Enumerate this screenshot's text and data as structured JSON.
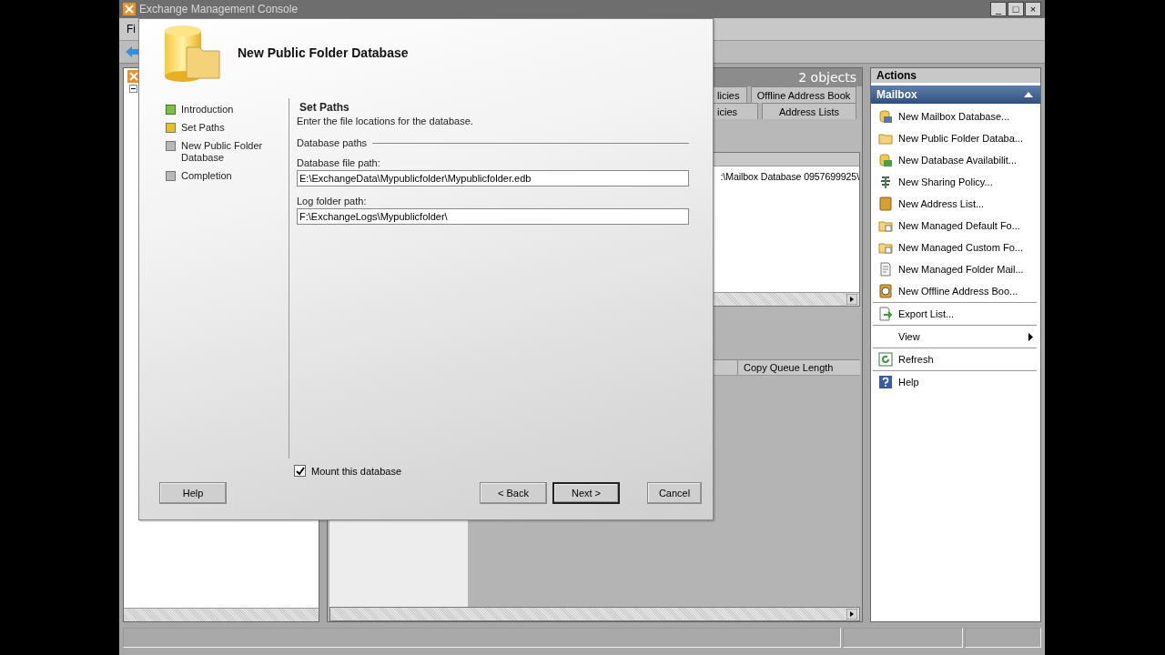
{
  "window": {
    "title": "Exchange Management Console",
    "controls": [
      "_",
      "□",
      "×"
    ]
  },
  "menu_bar": {
    "items": [
      "Fi"
    ]
  },
  "center_pane": {
    "count": "2 objects",
    "tabs_row_1": [
      {
        "label": "licies",
        "selected": false
      },
      {
        "label": "Offline Address Book",
        "selected": false
      }
    ],
    "tabs_row_2": [
      {
        "label": "icies",
        "selected": false
      },
      {
        "label": "Address Lists",
        "selected": false
      }
    ],
    "rows": [
      {
        "cell": ":\\Mailbox Database 0957699925\\"
      }
    ],
    "copies_columns": [
      "Copy Queue Length"
    ]
  },
  "actions_pane": {
    "title": "Actions",
    "section": {
      "title": "Mailbox",
      "expanded": true
    },
    "groups": [
      [
        {
          "label": "New Mailbox Database...",
          "kind": "action"
        },
        {
          "label": "New Public Folder Databa...",
          "kind": "action"
        },
        {
          "label": "New Database Availabilit...",
          "kind": "action"
        },
        {
          "label": "New Sharing Policy...",
          "kind": "action"
        },
        {
          "label": "New Address List...",
          "kind": "action"
        },
        {
          "label": "New Managed Default Fo...",
          "kind": "action"
        },
        {
          "label": "New Managed Custom Fo...",
          "kind": "action"
        },
        {
          "label": "New Managed Folder Mail...",
          "kind": "action"
        },
        {
          "label": "New Offline Address Boo...",
          "kind": "action"
        }
      ],
      [
        {
          "label": "Export List...",
          "kind": "action"
        }
      ],
      [
        {
          "label": "View",
          "kind": "submenu"
        }
      ],
      [
        {
          "label": "Refresh",
          "kind": "action"
        }
      ],
      [
        {
          "label": "Help",
          "kind": "action"
        }
      ]
    ]
  },
  "dialog": {
    "title": "New Public Folder Database",
    "steps": [
      {
        "label": "Introduction",
        "completed": true,
        "selected": false
      },
      {
        "label": "Set Paths",
        "completed": false,
        "selected": true
      },
      {
        "label": "New Public Folder Database",
        "completed": false,
        "selected": false
      },
      {
        "label": "Completion",
        "completed": false,
        "selected": false
      }
    ],
    "heading": "Set Paths",
    "description": "Enter the file locations for the database.",
    "group": "Database paths",
    "fields": [
      {
        "label": "Database file path:",
        "value": "E:\\ExchangeData\\Mypublicfolder\\Mypublicfolder.edb"
      },
      {
        "label": "Log folder path:",
        "value": "F:\\ExchangeLogs\\Mypublicfolder\\"
      }
    ],
    "mount": {
      "label": "Mount this database",
      "checked": true
    },
    "help_button": "Help",
    "buttons": [
      {
        "label": "< Back",
        "default": false
      },
      {
        "label": "Next >",
        "default": true
      },
      {
        "label": "Cancel",
        "default": false
      }
    ]
  }
}
